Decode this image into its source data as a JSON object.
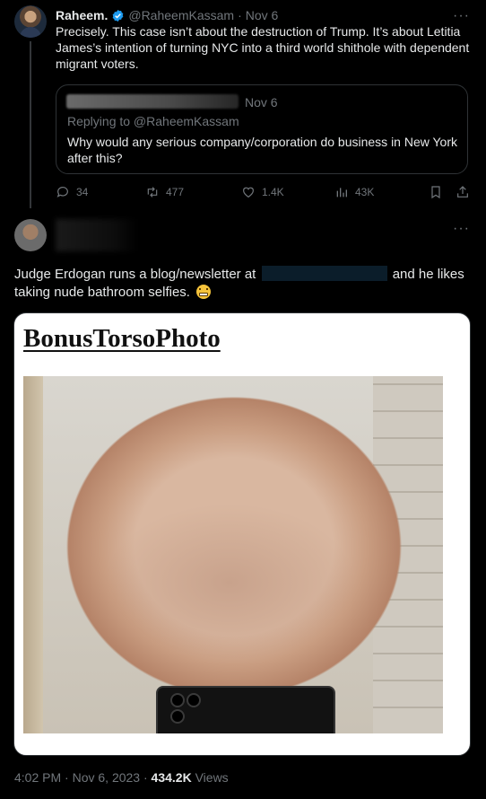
{
  "quoted_tweet_author": {
    "name": "Raheem.",
    "handle": "@RaheemKassam",
    "separator": "·",
    "date": "Nov 6",
    "verified": true
  },
  "quoted_tweet": {
    "text": "Precisely. This case isn’t about the destruction of Trump. It’s about Letitia James’s intention of turning NYC into a third world shithole with dependent migrant voters.",
    "inner_quote": {
      "date": "Nov 6",
      "replying_to": "Replying to @RaheemKassam",
      "text": "Why would any serious company/corporation do business in New York after this?"
    },
    "actions": {
      "replies": "34",
      "reposts": "477",
      "likes": "1.4K",
      "views": "43K"
    }
  },
  "main_tweet": {
    "text_before": "Judge Erdogan runs a blog/newsletter at",
    "text_after": "and he likes taking nude bathroom selfies.",
    "media_title": "BonusTorsoPhoto",
    "time": "4:02 PM",
    "date": "Nov 6, 2023",
    "separator": "·",
    "views_count": "434.2K",
    "views_label": "Views"
  },
  "colors": {
    "background": "#000000",
    "text": "#e7e9ea",
    "muted": "#71767b",
    "verified": "#1d9bf0",
    "border": "#2f3336"
  },
  "icons": [
    "verified-badge-icon",
    "more-icon",
    "reply-icon",
    "repost-icon",
    "like-icon",
    "views-icon",
    "bookmark-icon",
    "share-icon",
    "grimace-emoji-icon"
  ]
}
